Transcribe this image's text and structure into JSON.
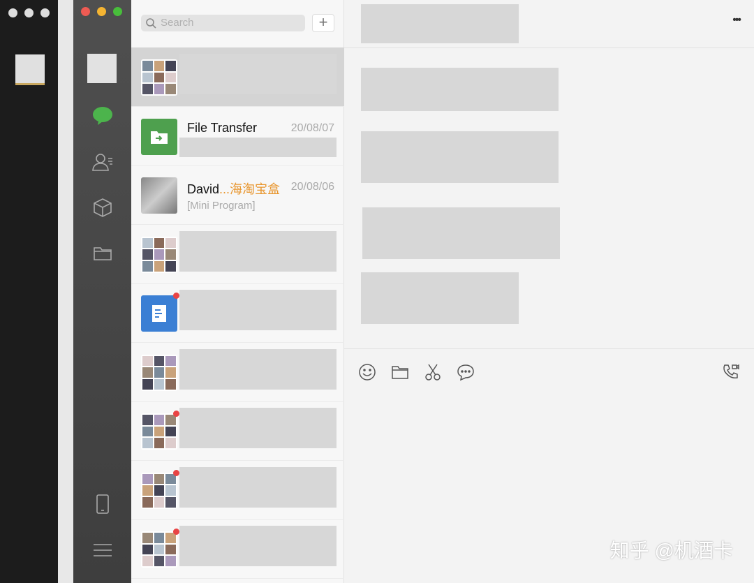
{
  "search": {
    "placeholder": "Search"
  },
  "add_label": "+",
  "chats": [
    {
      "name": "",
      "time": "",
      "sub": "",
      "selected": true
    },
    {
      "name": "File Transfer",
      "time": "20/08/07",
      "sub": ""
    },
    {
      "name": "David",
      "name_highlight": "...海淘宝盒",
      "time": "20/08/06",
      "sub": "[Mini Program]"
    },
    {
      "name": "",
      "time": "",
      "sub": ""
    },
    {
      "name": "",
      "time": "",
      "sub": "",
      "unread": true
    },
    {
      "name": "",
      "time": "",
      "sub": ""
    },
    {
      "name": "",
      "time": "",
      "sub": "",
      "unread": true
    },
    {
      "name": "",
      "time": "",
      "sub": "",
      "unread": true
    },
    {
      "name": "",
      "time": "",
      "sub": "",
      "unread": true
    }
  ],
  "chat": {
    "more_label": "•••"
  },
  "watermark": "知乎 @机酒卡",
  "colors": {
    "accent": "#4cb44c",
    "highlight": "#e8962e",
    "unread": "#e94444"
  }
}
